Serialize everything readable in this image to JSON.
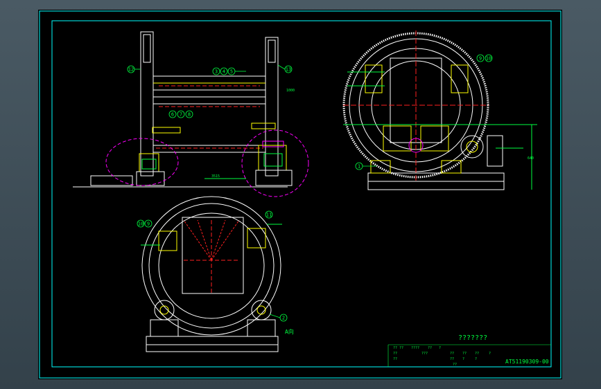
{
  "drawing": {
    "title": "???????",
    "drawing_number": "AT51190309-00",
    "view_label": "A向"
  },
  "balloons": [
    "12",
    "3",
    "4",
    "5",
    "13",
    "6",
    "7",
    "8",
    "1",
    "9",
    "10",
    "2",
    "10",
    "9",
    "11"
  ],
  "title_block": {
    "row1": [
      "?? ??",
      "????",
      "??",
      "?"
    ],
    "row2": [
      "??",
      "???",
      "??",
      "??",
      "??",
      "?"
    ],
    "row3": [
      "??",
      "??",
      "?",
      "?"
    ],
    "row4": [
      "??"
    ]
  },
  "colors": {
    "background": "#000000",
    "frame": "#00ffff",
    "outline": "#ffffff",
    "machine": "#ffff00",
    "center_line": "#ff2020",
    "hidden": "#ff00ff",
    "dimension": "#00ff40"
  }
}
